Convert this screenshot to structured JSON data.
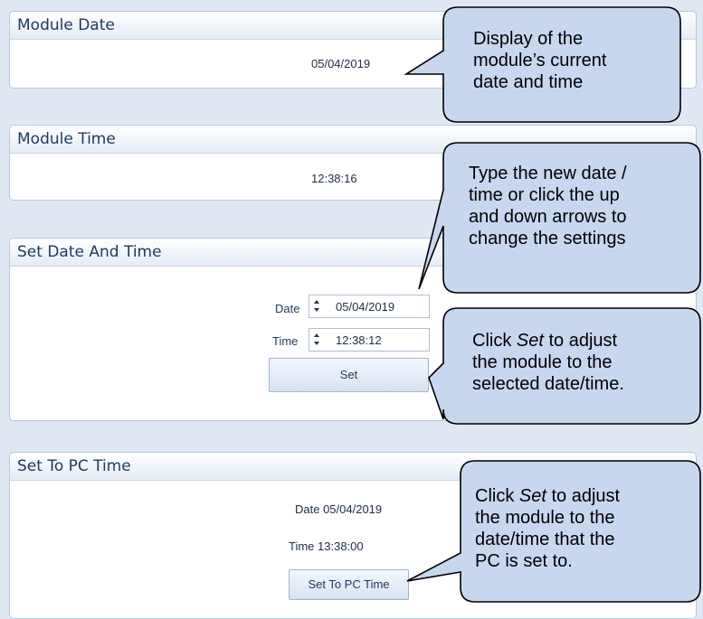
{
  "panels": {
    "module_date": {
      "title": "Module Date",
      "value": "05/04/2019"
    },
    "module_time": {
      "title": "Module Time",
      "value": "12:38:16"
    },
    "set_date_time": {
      "title": "Set Date And Time",
      "date_label": "Date",
      "date_value": "05/04/2019",
      "time_label": "Time",
      "time_value": "12:38:12",
      "set_button": "Set"
    },
    "set_to_pc": {
      "title": "Set To PC Time",
      "date_text": "Date 05/04/2019",
      "time_text": "Time 13:38:00",
      "button": "Set To PC Time"
    }
  },
  "callouts": {
    "c1": [
      "Display of the",
      "module’s current",
      "date and time"
    ],
    "c2": [
      "Type the new date /",
      "time or click the up",
      "and down arrows to",
      "change the settings"
    ],
    "c3_set": "Set",
    "c3_line1_rest": " to adjust",
    "c3": [
      "the module to the",
      "selected date/time."
    ],
    "c4_set": "Set",
    "c4_line1_rest": " to adjust",
    "c4": [
      "the module to the",
      "date/time that the",
      "PC is set to."
    ],
    "click_prefix": "Click "
  },
  "colors": {
    "callout_fill": "#c7d7ee",
    "callout_stroke": "#000000",
    "panel_header_text": "#1e3a5a",
    "background": "#dfe8f3"
  }
}
